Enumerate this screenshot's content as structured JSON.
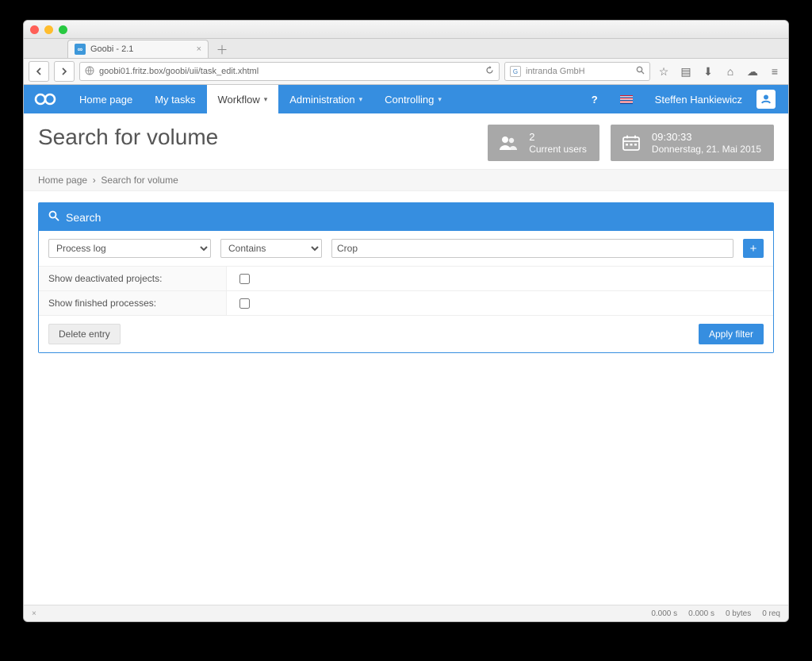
{
  "browser": {
    "tab_title": "Goobi - 2.1",
    "url": "goobi01.fritz.box/goobi/uii/task_edit.xhtml",
    "search_placeholder": "intranda GmbH"
  },
  "nav": {
    "items": [
      {
        "label": "Home page",
        "active": false,
        "dropdown": false
      },
      {
        "label": "My tasks",
        "active": false,
        "dropdown": false
      },
      {
        "label": "Workflow",
        "active": true,
        "dropdown": true
      },
      {
        "label": "Administration",
        "active": false,
        "dropdown": true
      },
      {
        "label": "Controlling",
        "active": false,
        "dropdown": true
      }
    ],
    "user_name": "Steffen Hankiewicz"
  },
  "widgets": {
    "users": {
      "count": "2",
      "label": "Current users"
    },
    "clock": {
      "time": "09:30:33",
      "date": "Donnerstag, 21. Mai 2015"
    }
  },
  "breadcrumb": {
    "home": "Home page",
    "current": "Search for volume"
  },
  "page_title": "Search for volume",
  "search_panel": {
    "title": "Search",
    "field": "Process log",
    "operator": "Contains",
    "value": "Crop",
    "show_deactivated_label": "Show deactivated projects:",
    "show_deactivated": false,
    "show_finished_label": "Show finished processes:",
    "show_finished": false,
    "delete_label": "Delete entry",
    "apply_label": "Apply filter"
  },
  "status": {
    "t1": "0.000 s",
    "t2": "0.000 s",
    "bytes": "0 bytes",
    "req": "0 req"
  }
}
